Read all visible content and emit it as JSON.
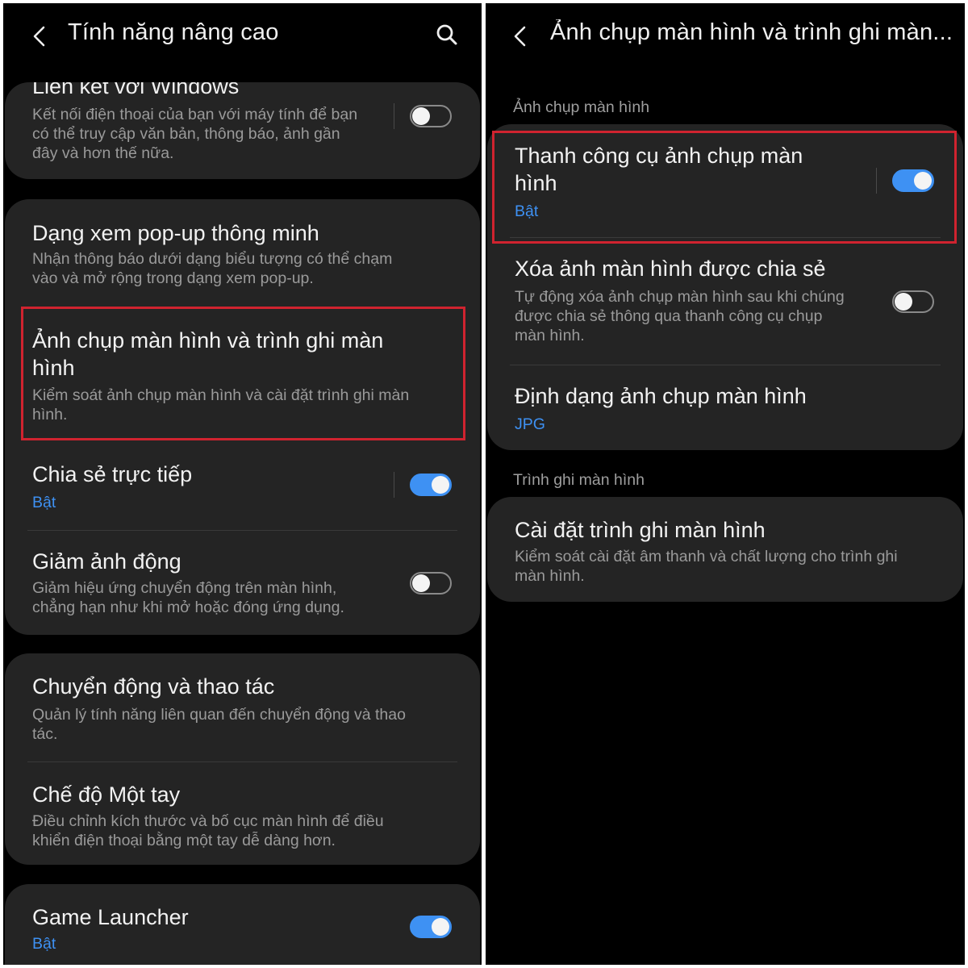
{
  "left": {
    "header": {
      "title": "Tính năng nâng cao",
      "back_icon": "chevron-left-icon",
      "search_icon": "search-icon"
    },
    "items": [
      {
        "title": "Liên kết với Windows",
        "desc": [
          "Kết nối điện thoại của bạn với máy tính để bạn",
          "có thể truy cập văn bản, thông báo, ảnh gần",
          "đây và hơn thế nữa."
        ],
        "toggle": false
      },
      {
        "title": "Dạng xem pop-up thông minh",
        "desc": [
          "Nhận thông báo dưới dạng biểu tượng có thể chạm",
          "vào và mở rộng trong dạng xem pop-up."
        ]
      },
      {
        "title": [
          "Ảnh chụp màn hình và trình ghi màn",
          "hình"
        ],
        "desc": [
          "Kiểm soát ảnh chụp màn hình và cài đặt trình ghi màn",
          "hình."
        ]
      },
      {
        "title": "Chia sẻ trực tiếp",
        "status": "Bật",
        "toggle": true
      },
      {
        "title": "Giảm ảnh động",
        "desc": [
          "Giảm hiệu ứng chuyển động trên màn hình,",
          "chẳng hạn như khi mở hoặc đóng ứng dụng."
        ],
        "toggle": false
      },
      {
        "title": "Chuyển động và thao tác",
        "desc": [
          "Quản lý tính năng liên quan đến chuyển động và thao",
          "tác."
        ]
      },
      {
        "title": "Chế độ Một tay",
        "desc": [
          "Điều chỉnh kích thước và bố cục màn hình để điều",
          "khiển điện thoại bằng một tay dễ dàng hơn."
        ]
      },
      {
        "title": "Game Launcher",
        "status": "Bật",
        "toggle": true
      }
    ]
  },
  "right": {
    "header": {
      "title": "Ảnh chụp màn hình và trình ghi màn...",
      "back_icon": "chevron-left-icon"
    },
    "sections": [
      {
        "label": "Ảnh chụp màn hình"
      },
      {
        "label": "Trình ghi màn hình"
      }
    ],
    "items": [
      {
        "title": [
          "Thanh công cụ ảnh chụp màn",
          "hình"
        ],
        "status": "Bật",
        "toggle": true
      },
      {
        "title": "Xóa ảnh màn hình được chia sẻ",
        "desc": [
          "Tự động xóa ảnh chụp màn hình sau khi chúng",
          "được chia sẻ thông qua thanh công cụ chụp",
          "màn hình."
        ],
        "toggle": false
      },
      {
        "title": "Định dạng ảnh chụp màn hình",
        "status": "JPG"
      },
      {
        "title": "Cài đặt trình ghi màn hình",
        "desc": [
          "Kiểm soát cài đặt âm thanh và chất lượng cho trình ghi",
          "màn hình."
        ]
      }
    ]
  },
  "colors": {
    "accent": "#3e91f3",
    "highlight": "#d0232f",
    "card": "#242424",
    "background": "#000000"
  }
}
